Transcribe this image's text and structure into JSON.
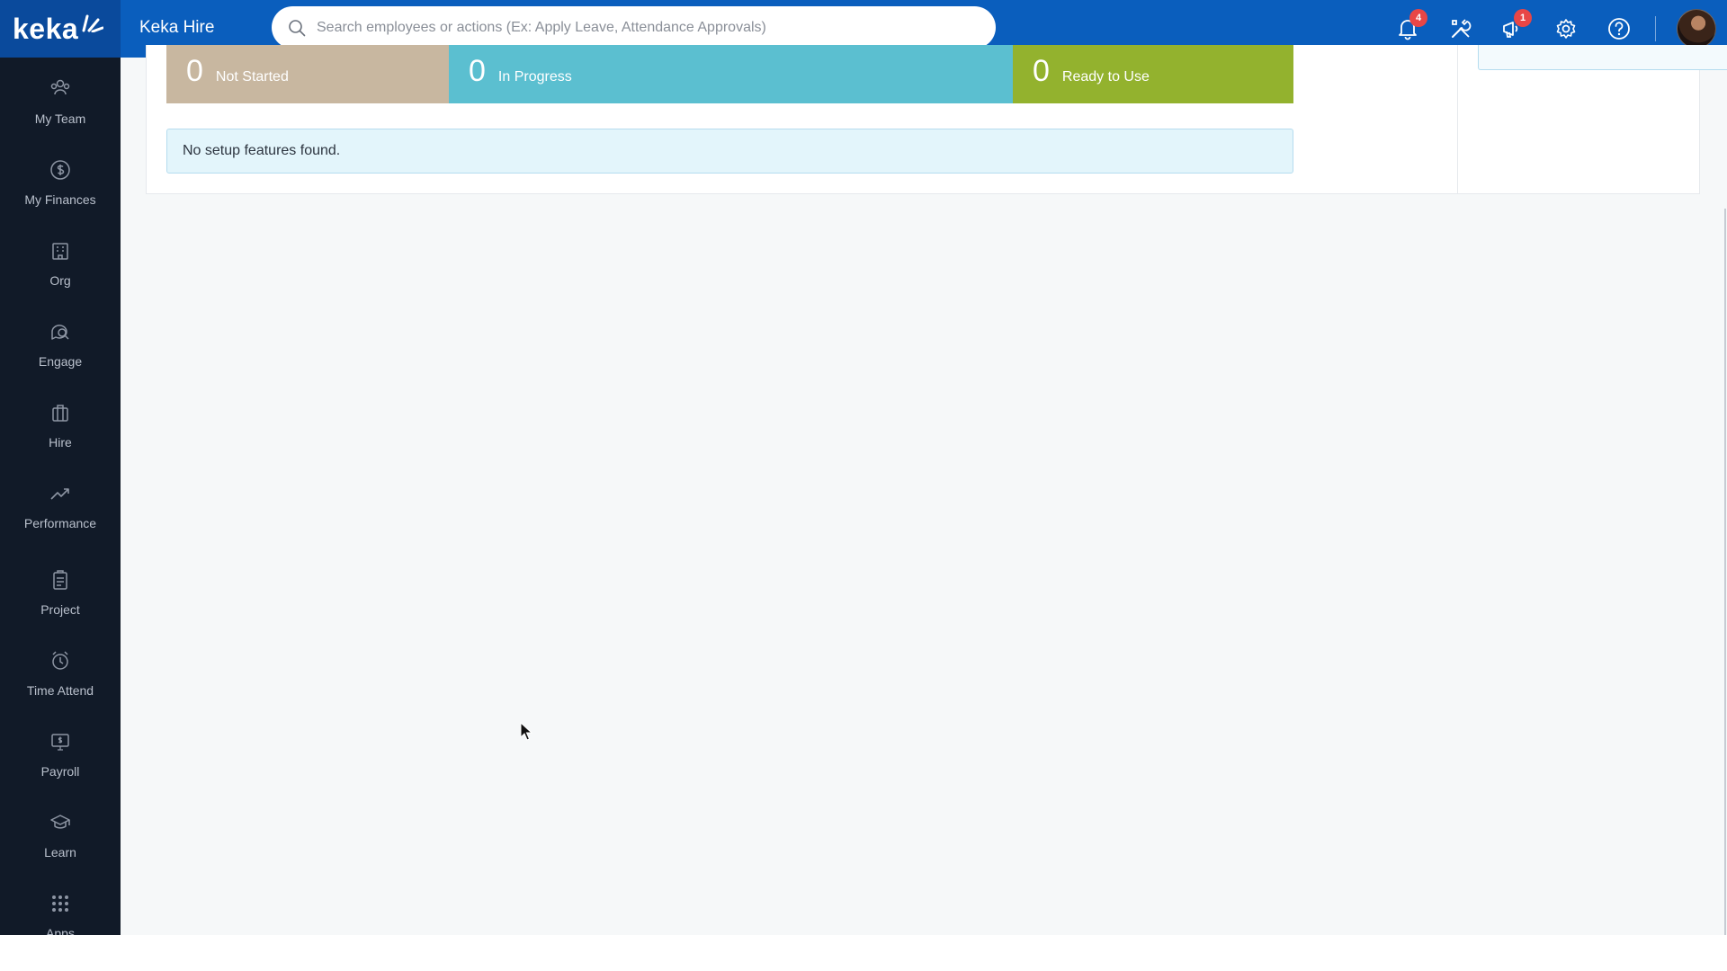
{
  "header": {
    "logo_text": "keka",
    "app_title": "Keka Hire",
    "search_placeholder": "Search employees or actions (Ex: Apply Leave, Attendance Approvals)",
    "notifications_badge": "4",
    "updates_badge": "1",
    "icons": [
      "bell-icon",
      "tools-icon",
      "announcement-icon",
      "gear-icon",
      "help-icon"
    ],
    "brand_color": "#0a5ebd"
  },
  "sidebar": {
    "items": [
      {
        "label": "My Team",
        "icon": "team-icon"
      },
      {
        "label": "My Finances",
        "icon": "dollar-icon"
      },
      {
        "label": "Org",
        "icon": "org-icon"
      },
      {
        "label": "Engage",
        "icon": "engage-icon"
      },
      {
        "label": "Hire",
        "icon": "briefcase-icon"
      },
      {
        "label": "Performance",
        "icon": "trend-icon"
      },
      {
        "label": "Project",
        "icon": "clipboard-icon"
      },
      {
        "label": "Time Attend",
        "icon": "clock-icon"
      },
      {
        "label": "Payroll",
        "icon": "payroll-icon"
      },
      {
        "label": "Learn",
        "icon": "graduation-icon"
      },
      {
        "label": "Apps",
        "icon": "grid-icon"
      }
    ]
  },
  "setup_status": {
    "not_started": {
      "count": "0",
      "label": "Not Started",
      "color": "#c8b7a0"
    },
    "in_progress": {
      "count": "0",
      "label": "In Progress",
      "color": "#5bbfd0"
    },
    "ready_to_use": {
      "count": "0",
      "label": "Ready to Use",
      "color": "#93b22e"
    }
  },
  "message": "No setup features found."
}
